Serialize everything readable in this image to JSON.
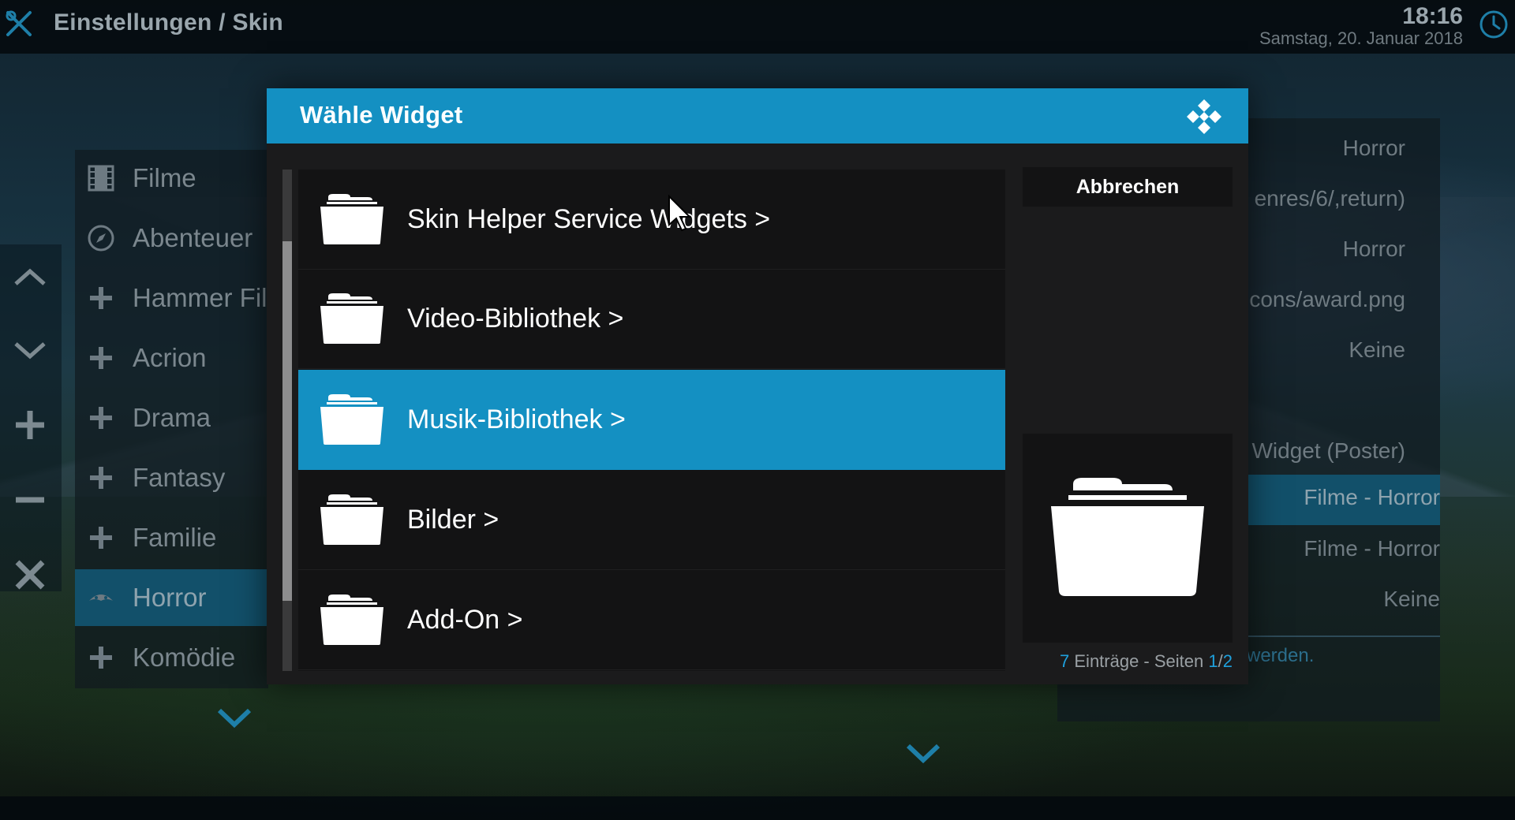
{
  "topbar": {
    "title": "Einstellungen / Skin",
    "time": "18:16",
    "date": "Samstag, 20. Januar 2018",
    "logo_icon": "kodi-logo-icon",
    "clock_icon": "clock-icon"
  },
  "side_controls": [
    {
      "icon": "chevron-up-icon"
    },
    {
      "icon": "chevron-down-icon"
    },
    {
      "icon": "plus-icon"
    },
    {
      "icon": "minus-icon"
    },
    {
      "icon": "close-icon"
    }
  ],
  "background_list": {
    "items": [
      {
        "label": "Filme",
        "icon": "film-icon"
      },
      {
        "label": "Abenteuer",
        "icon": "compass-icon"
      },
      {
        "label": "Hammer Fil",
        "icon": "plus-icon"
      },
      {
        "label": "Acrion",
        "icon": "plus-icon"
      },
      {
        "label": "Drama",
        "icon": "plus-icon"
      },
      {
        "label": "Fantasy",
        "icon": "plus-icon"
      },
      {
        "label": "Familie",
        "icon": "plus-icon"
      },
      {
        "label": "Horror",
        "icon": "mask-icon",
        "active": true
      },
      {
        "label": "Komödie",
        "icon": "plus-icon"
      }
    ]
  },
  "background_right": {
    "rows": [
      "Horror",
      "enres/6/,return)",
      "Horror",
      "cons/award.png",
      "Keine",
      "",
      "Widget (Poster)",
      "Filme - Horror",
      "Filme - Horror",
      "Keine"
    ],
    "hint": "werden."
  },
  "dialog": {
    "title": "Wähle Widget",
    "logo_icon": "kodi-logo-icon",
    "items": [
      {
        "label": "Skin Helper Service Widgets  >",
        "icon": "folder-icon"
      },
      {
        "label": "Video-Bibliothek  >",
        "icon": "folder-icon"
      },
      {
        "label": "Musik-Bibliothek  >",
        "icon": "folder-icon",
        "focused": true
      },
      {
        "label": "Bilder  >",
        "icon": "folder-icon"
      },
      {
        "label": "Add-On  >",
        "icon": "folder-icon"
      }
    ],
    "cancel_label": "Abbrechen",
    "preview_icon": "folder-icon",
    "count": {
      "entries": "7",
      "entries_label": " Einträge - Seiten ",
      "page": "1",
      "sep": "/",
      "pages": "2"
    },
    "accent_color": "#1490c2"
  }
}
